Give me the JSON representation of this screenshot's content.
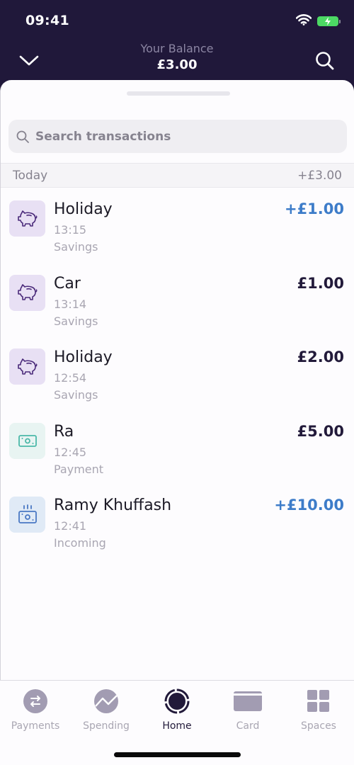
{
  "status_bar": {
    "time": "09:41",
    "icons": [
      "wifi-icon",
      "battery-charging-icon"
    ]
  },
  "header": {
    "balance_label": "Your Balance",
    "balance_value": "£3.00",
    "left_icon": "chevron-down-icon",
    "right_icon": "search-icon"
  },
  "search": {
    "placeholder": "Search transactions",
    "value": ""
  },
  "section": {
    "label": "Today",
    "total": "+£3.00"
  },
  "transactions": [
    {
      "name": "Holiday",
      "time": "13:15",
      "category": "Savings",
      "amount": "+£1.00",
      "positive": true,
      "icon": "piggy-bank-icon"
    },
    {
      "name": "Car",
      "time": "13:14",
      "category": "Savings",
      "amount": "£1.00",
      "positive": false,
      "icon": "piggy-bank-icon"
    },
    {
      "name": "Holiday",
      "time": "12:54",
      "category": "Savings",
      "amount": "£2.00",
      "positive": false,
      "icon": "piggy-bank-icon"
    },
    {
      "name": "Ra",
      "time": "12:45",
      "category": "Payment",
      "amount": "£5.00",
      "positive": false,
      "icon": "banknote-icon"
    },
    {
      "name": "Ramy Khuffash",
      "time": "12:41",
      "category": "Incoming",
      "amount": "+£10.00",
      "positive": true,
      "icon": "incoming-money-icon"
    }
  ],
  "tabs": [
    {
      "label": "Payments",
      "icon": "transfer-icon",
      "active": false
    },
    {
      "label": "Spending",
      "icon": "spending-chart-icon",
      "active": false
    },
    {
      "label": "Home",
      "icon": "home-ring-icon",
      "active": true
    },
    {
      "label": "Card",
      "icon": "card-icon",
      "active": false
    },
    {
      "label": "Spaces",
      "icon": "spaces-grid-icon",
      "active": false
    }
  ],
  "colors": {
    "header_bg": "#20183a",
    "positive_amount": "#3d7cc9",
    "default_amount": "#221a3a",
    "savings_icon_bg": "#e8e0f4",
    "payment_icon_bg": "#e8f4f2",
    "incoming_icon_bg": "#e0eaf6"
  }
}
